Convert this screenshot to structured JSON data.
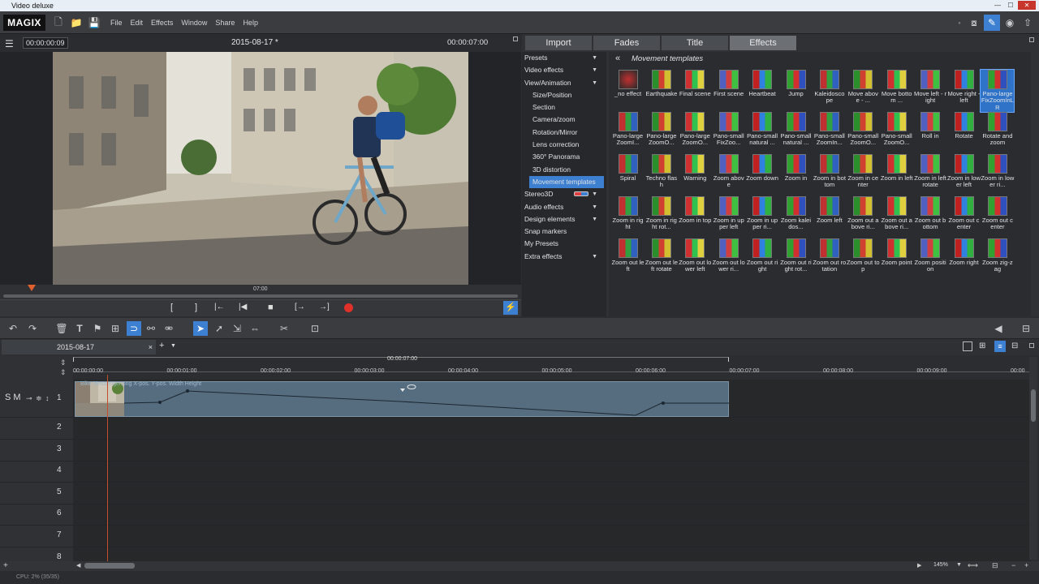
{
  "window": {
    "title": "Video deluxe"
  },
  "menubar": {
    "logo": "MAGIX",
    "items": [
      "File",
      "Edit",
      "Effects",
      "Window",
      "Share",
      "Help"
    ]
  },
  "preview": {
    "timecode_left": "00:00:00:09",
    "title": "2015-08-17 *",
    "timecode_right": "00:00:07:00",
    "scrub_label": "07:00"
  },
  "transport": {
    "in": "[",
    "out": "]",
    "prev_marker": "|←",
    "to_start": "|◀",
    "stop": "■",
    "next_marker": "[→",
    "to_end": "→]"
  },
  "tabs": [
    "Import",
    "Fades",
    "Title",
    "Effects"
  ],
  "active_tab": "Effects",
  "categories": [
    {
      "label": "Presets",
      "arrow": true,
      "sub": false
    },
    {
      "label": "Video effects",
      "arrow": true,
      "sub": false
    },
    {
      "label": "View/Animation",
      "arrow": true,
      "sub": false
    },
    {
      "label": "Size/Position",
      "arrow": false,
      "sub": true
    },
    {
      "label": "Section",
      "arrow": false,
      "sub": true
    },
    {
      "label": "Camera/zoom",
      "arrow": false,
      "sub": true
    },
    {
      "label": "Rotation/Mirror",
      "arrow": false,
      "sub": true
    },
    {
      "label": "Lens correction",
      "arrow": false,
      "sub": true
    },
    {
      "label": "360° Panorama",
      "arrow": false,
      "sub": true
    },
    {
      "label": "3D distortion",
      "arrow": false,
      "sub": true
    },
    {
      "label": "Movement templates",
      "arrow": false,
      "sub": true,
      "selected": true
    },
    {
      "label": "Stereo3D",
      "arrow": true,
      "sub": false
    },
    {
      "label": "Audio effects",
      "arrow": true,
      "sub": false
    },
    {
      "label": "Design elements",
      "arrow": true,
      "sub": false
    },
    {
      "label": "Snap markers",
      "arrow": false,
      "sub": false
    },
    {
      "label": "My Presets",
      "arrow": false,
      "sub": false
    },
    {
      "label": "Extra effects",
      "arrow": true,
      "sub": false
    }
  ],
  "effects_header": {
    "back": "«",
    "title": "Movement templates"
  },
  "effects": [
    "_no effect",
    "Earthquake",
    "Final scene",
    "First scene",
    "Heartbeat",
    "Jump",
    "Kaleidoscope",
    "Move above - ...",
    "Move bottom ...",
    "Move left - right",
    "Move right - left",
    "Pano-largeFixZoomInLR",
    "Pano-largeZoomI...",
    "Pano-largeZoomO...",
    "Pano-largeZoomO...",
    "Pano-smallFixZoo...",
    "Pano-smallnatural ...",
    "Pano-smallnatural ...",
    "Pano-smallZoomIn...",
    "Pano-smallZoomO...",
    "Pano-smallZoomO...",
    "Roll in",
    "Rotate",
    "Rotate and zoom",
    "Spiral",
    "Techno flash",
    "Warning",
    "Zoom above",
    "Zoom down",
    "Zoom in",
    "Zoom in bottom",
    "Zoom in center",
    "Zoom in left",
    "Zoom in left rotate",
    "Zoom in lower left",
    "Zoom in lower ri...",
    "Zoom in right",
    "Zoom in right rot...",
    "Zoom in top",
    "Zoom in upper left",
    "Zoom in upper ri...",
    "Zoom kaleidos...",
    "Zoom left",
    "Zoom out above ri...",
    "Zoom out above ri...",
    "Zoom out bottom",
    "Zoom out center",
    "Zoom out center",
    "Zoom out left",
    "Zoom out left rotate",
    "Zoom out lower left",
    "Zoom out lower ri...",
    "Zoom out right",
    "Zoom out right rot...",
    "Zoom out rotation",
    "Zoom out top",
    "Zoom point",
    "Zoom position",
    "Zoom right",
    "Zoom zig-zag"
  ],
  "selected_effect": "Pano-largeFixZoomInLR",
  "timeline": {
    "project_tab": "2015-08-17",
    "close": "×",
    "add": "+",
    "range_label": "00:00:07:00",
    "ruler_labels": [
      "00:00:00:00",
      "00:00:01:00",
      "00:00:02:00",
      "00:00:03:00",
      "00:00:04:00",
      "00:00:05:00",
      "00:00:06:00",
      "00:00:07:00",
      "00:00:08:00",
      "00:00:09:00",
      "00:00"
    ],
    "track_numbers": [
      "1",
      "2",
      "3",
      "4",
      "5",
      "6",
      "7",
      "8"
    ],
    "track1_controls": "S M",
    "clip_label": "Bike Messenger.png   X-pos.  Y-pos.  Width  Height",
    "zoom": "145%"
  },
  "status": {
    "text": "CPU: 2% (35/35)"
  },
  "colors": {
    "accent": "#3d7fd0",
    "record": "#e0302a",
    "playhead": "#c0502c",
    "clip": "#566d80"
  }
}
